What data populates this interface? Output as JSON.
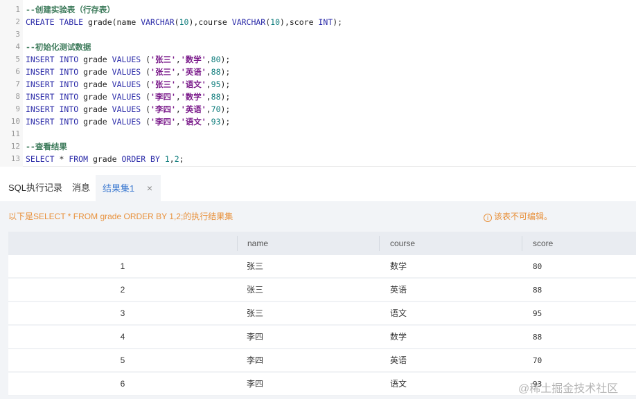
{
  "editor": {
    "lines": [
      {
        "n": "1",
        "tokens": [
          {
            "t": "--创建实验表（行存表）",
            "c": "comment"
          }
        ]
      },
      {
        "n": "2",
        "tokens": [
          {
            "t": "CREATE TABLE ",
            "c": "kw"
          },
          {
            "t": "grade(name ",
            "c": "plain"
          },
          {
            "t": "VARCHAR",
            "c": "kw"
          },
          {
            "t": "(",
            "c": "plain"
          },
          {
            "t": "10",
            "c": "num"
          },
          {
            "t": "),course ",
            "c": "plain"
          },
          {
            "t": "VARCHAR",
            "c": "kw"
          },
          {
            "t": "(",
            "c": "plain"
          },
          {
            "t": "10",
            "c": "num"
          },
          {
            "t": "),score ",
            "c": "plain"
          },
          {
            "t": "INT",
            "c": "kw"
          },
          {
            "t": ");",
            "c": "plain"
          }
        ]
      },
      {
        "n": "3",
        "tokens": []
      },
      {
        "n": "4",
        "tokens": [
          {
            "t": "--初始化测试数据",
            "c": "comment"
          }
        ]
      },
      {
        "n": "5",
        "tokens": [
          {
            "t": "INSERT INTO ",
            "c": "kw"
          },
          {
            "t": "grade ",
            "c": "plain"
          },
          {
            "t": "VALUES ",
            "c": "kw"
          },
          {
            "t": "(",
            "c": "plain"
          },
          {
            "t": "'张三'",
            "c": "str"
          },
          {
            "t": ",",
            "c": "plain"
          },
          {
            "t": "'数学'",
            "c": "str"
          },
          {
            "t": ",",
            "c": "plain"
          },
          {
            "t": "80",
            "c": "num"
          },
          {
            "t": ");",
            "c": "plain"
          }
        ]
      },
      {
        "n": "6",
        "tokens": [
          {
            "t": "INSERT INTO ",
            "c": "kw"
          },
          {
            "t": "grade ",
            "c": "plain"
          },
          {
            "t": "VALUES ",
            "c": "kw"
          },
          {
            "t": "(",
            "c": "plain"
          },
          {
            "t": "'张三'",
            "c": "str"
          },
          {
            "t": ",",
            "c": "plain"
          },
          {
            "t": "'英语'",
            "c": "str"
          },
          {
            "t": ",",
            "c": "plain"
          },
          {
            "t": "88",
            "c": "num"
          },
          {
            "t": ");",
            "c": "plain"
          }
        ]
      },
      {
        "n": "7",
        "tokens": [
          {
            "t": "INSERT INTO ",
            "c": "kw"
          },
          {
            "t": "grade ",
            "c": "plain"
          },
          {
            "t": "VALUES ",
            "c": "kw"
          },
          {
            "t": "(",
            "c": "plain"
          },
          {
            "t": "'张三'",
            "c": "str"
          },
          {
            "t": ",",
            "c": "plain"
          },
          {
            "t": "'语文'",
            "c": "str"
          },
          {
            "t": ",",
            "c": "plain"
          },
          {
            "t": "95",
            "c": "num"
          },
          {
            "t": ");",
            "c": "plain"
          }
        ]
      },
      {
        "n": "8",
        "tokens": [
          {
            "t": "INSERT INTO ",
            "c": "kw"
          },
          {
            "t": "grade ",
            "c": "plain"
          },
          {
            "t": "VALUES ",
            "c": "kw"
          },
          {
            "t": "(",
            "c": "plain"
          },
          {
            "t": "'李四'",
            "c": "str"
          },
          {
            "t": ",",
            "c": "plain"
          },
          {
            "t": "'数学'",
            "c": "str"
          },
          {
            "t": ",",
            "c": "plain"
          },
          {
            "t": "88",
            "c": "num"
          },
          {
            "t": ");",
            "c": "plain"
          }
        ]
      },
      {
        "n": "9",
        "tokens": [
          {
            "t": "INSERT INTO ",
            "c": "kw"
          },
          {
            "t": "grade ",
            "c": "plain"
          },
          {
            "t": "VALUES ",
            "c": "kw"
          },
          {
            "t": "(",
            "c": "plain"
          },
          {
            "t": "'李四'",
            "c": "str"
          },
          {
            "t": ",",
            "c": "plain"
          },
          {
            "t": "'英语'",
            "c": "str"
          },
          {
            "t": ",",
            "c": "plain"
          },
          {
            "t": "70",
            "c": "num"
          },
          {
            "t": ");",
            "c": "plain"
          }
        ]
      },
      {
        "n": "10",
        "tokens": [
          {
            "t": "INSERT INTO ",
            "c": "kw"
          },
          {
            "t": "grade ",
            "c": "plain"
          },
          {
            "t": "VALUES ",
            "c": "kw"
          },
          {
            "t": "(",
            "c": "plain"
          },
          {
            "t": "'李四'",
            "c": "str"
          },
          {
            "t": ",",
            "c": "plain"
          },
          {
            "t": "'语文'",
            "c": "str"
          },
          {
            "t": ",",
            "c": "plain"
          },
          {
            "t": "93",
            "c": "num"
          },
          {
            "t": ");",
            "c": "plain"
          }
        ]
      },
      {
        "n": "11",
        "tokens": []
      },
      {
        "n": "12",
        "tokens": [
          {
            "t": "--查看结果",
            "c": "comment"
          }
        ]
      },
      {
        "n": "13",
        "tokens": [
          {
            "t": "SELECT ",
            "c": "kw"
          },
          {
            "t": "* ",
            "c": "plain"
          },
          {
            "t": "FROM ",
            "c": "kw"
          },
          {
            "t": "grade ",
            "c": "plain"
          },
          {
            "t": "ORDER BY ",
            "c": "kw"
          },
          {
            "t": "1",
            "c": "num"
          },
          {
            "t": ",",
            "c": "plain"
          },
          {
            "t": "2",
            "c": "num"
          },
          {
            "t": ";",
            "c": "plain"
          }
        ]
      }
    ]
  },
  "tabs": {
    "sql_history": "SQL执行记录",
    "messages": "消息",
    "result_set": "结果集1",
    "close_glyph": "×"
  },
  "result": {
    "info": "以下是SELECT * FROM grade ORDER BY 1,2;的执行结果集",
    "readonly_icon": "i",
    "readonly_note": "该表不可编辑。",
    "columns": [
      "",
      "name",
      "course",
      "score"
    ],
    "rows": [
      {
        "idx": "1",
        "name": "张三",
        "course": "数学",
        "score": "80"
      },
      {
        "idx": "2",
        "name": "张三",
        "course": "英语",
        "score": "88"
      },
      {
        "idx": "3",
        "name": "张三",
        "course": "语文",
        "score": "95"
      },
      {
        "idx": "4",
        "name": "李四",
        "course": "数学",
        "score": "88"
      },
      {
        "idx": "5",
        "name": "李四",
        "course": "英语",
        "score": "70"
      },
      {
        "idx": "6",
        "name": "李四",
        "course": "语文",
        "score": "93"
      }
    ]
  },
  "watermark": "@稀土掘金技术社区"
}
